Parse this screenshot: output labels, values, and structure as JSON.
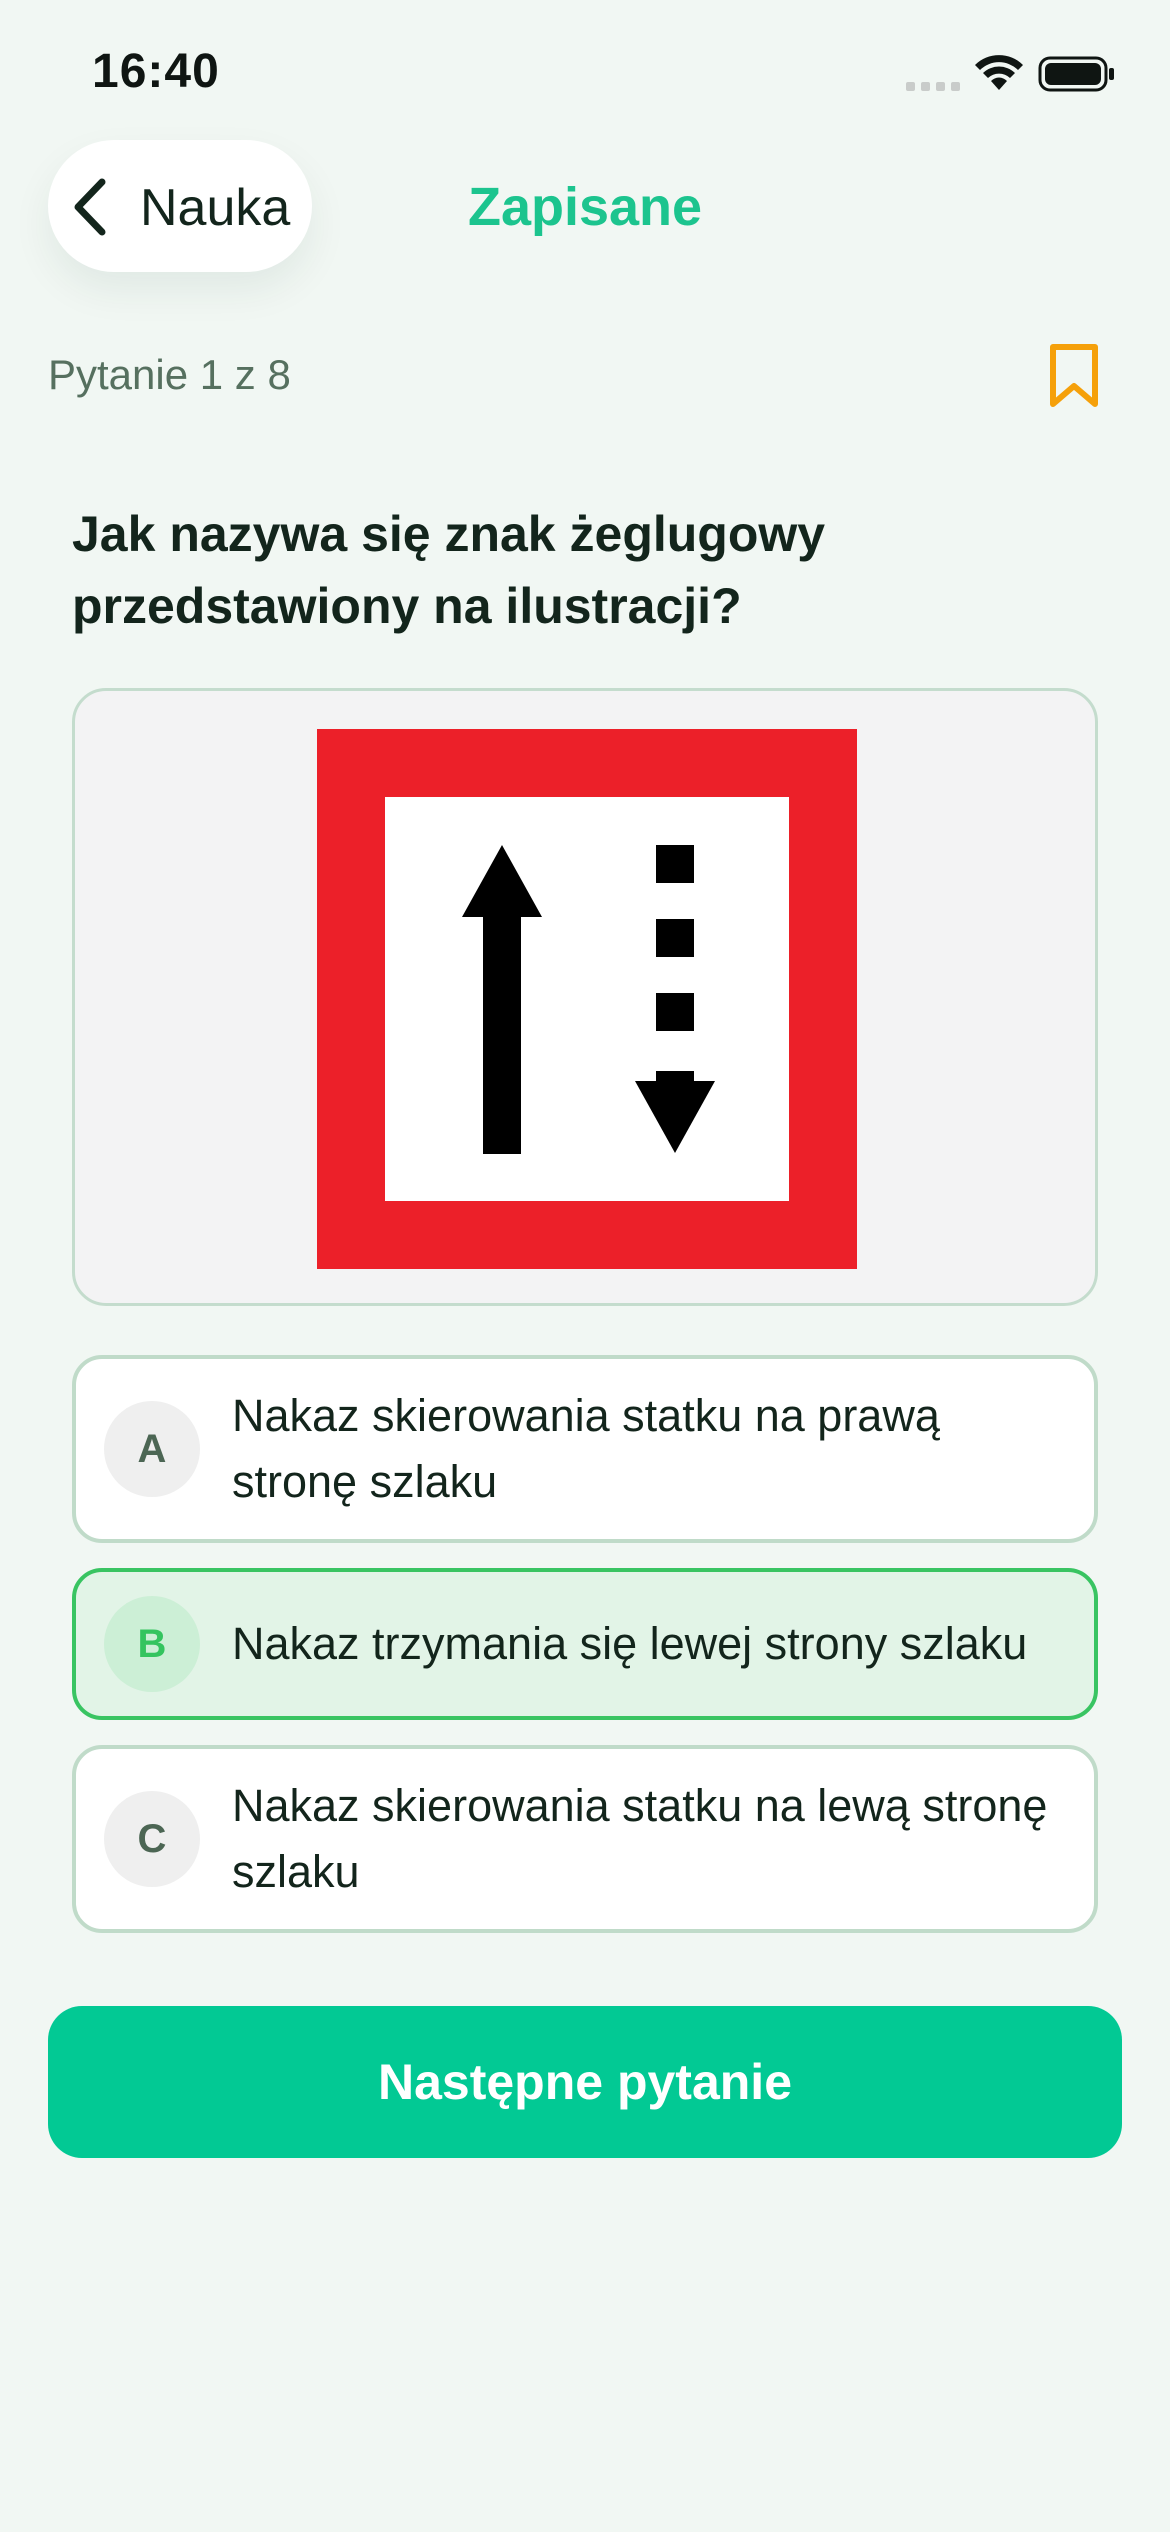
{
  "status_bar": {
    "time": "16:40"
  },
  "nav": {
    "back_label": "Nauka",
    "title": "Zapisane"
  },
  "progress": {
    "label": "Pytanie 1 z 8"
  },
  "question": {
    "text": "Jak nazywa się znak żeglugowy przedstawiony na ilustracji?"
  },
  "sign": {
    "frame_color": "#ec2029",
    "inner_color": "#ffffff",
    "arrow_color": "#000000",
    "icon": "two-way-traffic-sign-icon"
  },
  "answers": [
    {
      "letter": "A",
      "text": "Nakaz skierowania statku na prawą stronę szlaku",
      "selected": false
    },
    {
      "letter": "B",
      "text": "Nakaz trzymania się lewej strony szlaku",
      "selected": true
    },
    {
      "letter": "C",
      "text": "Nakaz skierowania statku na lewą stronę szlaku",
      "selected": false
    }
  ],
  "actions": {
    "next_label": "Następne pytanie"
  },
  "colors": {
    "accent": "#02c994",
    "title_accent": "#1cc48e",
    "bookmark": "#f5a00a",
    "selected_border": "#39c462",
    "selected_background": "#e2f4e7",
    "background": "#f1f7f3"
  },
  "icons": {
    "back": "chevron-left-icon",
    "bookmark": "bookmark-icon",
    "signal": "cellular-signal-icon",
    "wifi": "wifi-icon",
    "battery": "battery-icon"
  }
}
